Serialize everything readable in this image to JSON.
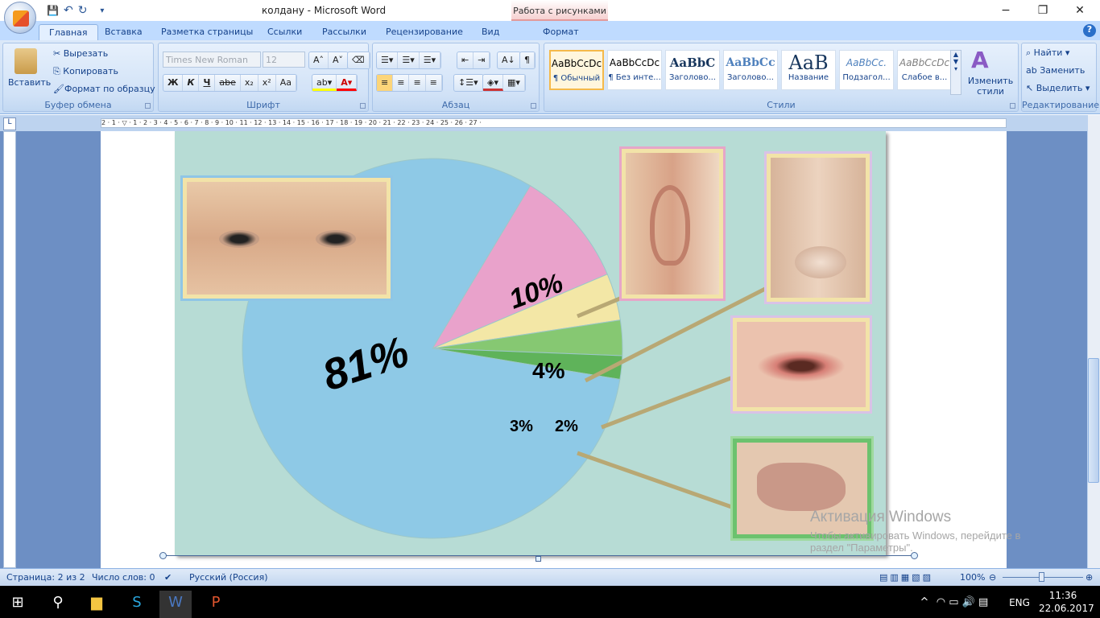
{
  "window": {
    "title": "колдану - Microsoft Word",
    "context_tab_group": "Работа с рисунками",
    "minimize": "−",
    "restore": "❐",
    "close": "✕"
  },
  "qat": {
    "save": "💾",
    "undo": "↶",
    "redo": "↻",
    "customize": "▾"
  },
  "tabs": [
    "Главная",
    "Вставка",
    "Разметка страницы",
    "Ссылки",
    "Рассылки",
    "Рецензирование",
    "Вид",
    "Формат"
  ],
  "help": "?",
  "clipboard": {
    "paste": "Вставить",
    "cut": "Вырезать",
    "copy": "Копировать",
    "format_painter": "Формат по образцу",
    "label": "Буфер обмена"
  },
  "font": {
    "name": "Times New Roman",
    "size": "12",
    "bold": "Ж",
    "italic": "К",
    "underline": "Ч",
    "strike": "abe",
    "sub": "x₂",
    "sup": "x²",
    "case": "Aa",
    "grow": "A˄",
    "shrink": "A˅",
    "label": "Шрифт"
  },
  "paragraph": {
    "label": "Абзац",
    "pilcrow": "¶",
    "sort": "А↓"
  },
  "styles": {
    "label": "Стили",
    "change": "Изменить стили",
    "items": [
      {
        "preview": "AaBbCcDc",
        "name": "¶ Обычный"
      },
      {
        "preview": "AaBbCcDc",
        "name": "¶ Без инте..."
      },
      {
        "preview": "AaBbC",
        "name": "Заголово..."
      },
      {
        "preview": "AaBbCc",
        "name": "Заголово..."
      },
      {
        "preview": "AaB",
        "name": "Название"
      },
      {
        "preview": "AaBbCc.",
        "name": "Подзагол..."
      },
      {
        "preview": "AaBbCcDc",
        "name": "Слабое в..."
      }
    ]
  },
  "editing": {
    "find": "Найти",
    "replace": "Заменить",
    "select": "Выделить",
    "label": "Редактирование"
  },
  "ruler": {
    "tab_stop": "L",
    "marks": "2 · 1 · ▽ · 1 · 2 · 3 · 4 · 5 · 6 · 7 · 8 · 9 · 10 · 11 · 12 · 13 · 14 · 15 · 16 · 17 · 18 · 19 · 20 · 21 · 22 · 23 · 24 · 25 · 26 · 27 ·"
  },
  "picture": {
    "slices": [
      {
        "label": "81%",
        "value": 81,
        "color": "#8ec9e6"
      },
      {
        "label": "10%",
        "value": 10,
        "color": "#e9a2cb"
      },
      {
        "label": "4%",
        "value": 4,
        "color": "#f3e7a6"
      },
      {
        "label": "3%",
        "value": 3,
        "color": "#86c872"
      },
      {
        "label": "2%",
        "value": 2,
        "color": "#5fb35a"
      }
    ]
  },
  "watermark": {
    "title": "Активация Windows",
    "line1": "Чтобы активировать Windows, перейдите в",
    "line2": "раздел \"Параметры\"."
  },
  "status": {
    "page": "Страница: 2 из 2",
    "words": "Число слов: 0",
    "language": "Русский (Россия)",
    "zoom": "100%"
  },
  "taskbar": {
    "time": "11:36",
    "date": "22.06.2017",
    "lang": "ENG"
  }
}
